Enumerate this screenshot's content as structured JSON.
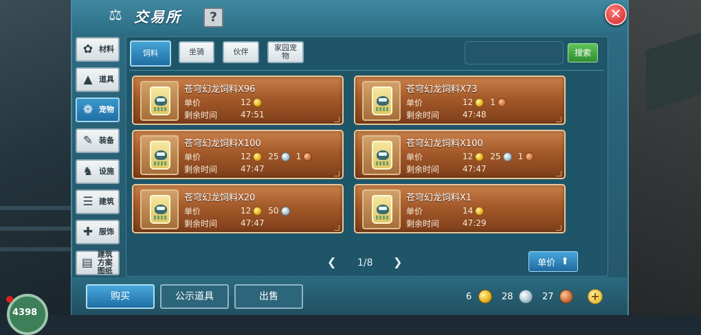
{
  "window": {
    "title": "交易所",
    "help_label": "?",
    "close_label": "✕"
  },
  "sidebar": {
    "items": [
      {
        "label": "材料",
        "icon": "material-icon",
        "active": false
      },
      {
        "label": "道具",
        "icon": "item-icon",
        "active": false
      },
      {
        "label": "宠物",
        "icon": "paw-icon",
        "active": true
      },
      {
        "label": "装备",
        "icon": "equipment-icon",
        "active": false
      },
      {
        "label": "设施",
        "icon": "facility-icon",
        "active": false
      },
      {
        "label": "建筑",
        "icon": "building-icon",
        "active": false
      },
      {
        "label": "服饰",
        "icon": "clothing-icon",
        "active": false
      },
      {
        "label": "建筑方案图纸",
        "icon": "blueprint-icon",
        "active": false
      }
    ]
  },
  "tabs": [
    {
      "label": "饲料",
      "active": true
    },
    {
      "label": "坐骑",
      "active": false
    },
    {
      "label": "伙伴",
      "active": false
    },
    {
      "label": "家园宠物",
      "active": false
    }
  ],
  "search": {
    "placeholder": "",
    "button_label": "搜索"
  },
  "labels": {
    "unit_price": "单价",
    "time_left": "剩余时间"
  },
  "listings": [
    {
      "name": "苍穹幻龙饲料X96",
      "gold": "12",
      "silver": "",
      "copper": "",
      "time": "47:51"
    },
    {
      "name": "苍穹幻龙饲料X73",
      "gold": "12",
      "silver": "",
      "copper": "1",
      "time": "47:48"
    },
    {
      "name": "苍穹幻龙饲料X100",
      "gold": "12",
      "silver": "25",
      "copper": "1",
      "time": "47:47"
    },
    {
      "name": "苍穹幻龙饲料X100",
      "gold": "12",
      "silver": "25",
      "copper": "1",
      "time": "47:47"
    },
    {
      "name": "苍穹幻龙饲料X20",
      "gold": "12",
      "silver": "50",
      "copper": "",
      "time": "47:47"
    },
    {
      "name": "苍穹幻龙饲料X1",
      "gold": "14",
      "silver": "",
      "copper": "",
      "time": "47:29"
    }
  ],
  "pagination": {
    "prev": "❮",
    "label": "1/8",
    "next": "❯"
  },
  "sort": {
    "label": "单价",
    "icon": "sort-arrow-icon"
  },
  "footer": {
    "buy_label": "购买",
    "public_label": "公示道具",
    "sell_label": "出售",
    "gold": "6",
    "silver": "28",
    "copper": "27",
    "add_label": "+"
  },
  "hud": {
    "number": "4398"
  },
  "colors": {
    "accent": "#1f6ea4",
    "listing_bg": "#a45a2a",
    "panel_bg": "#2a6278",
    "search_green": "#2f8e33",
    "close_red": "#d02424"
  }
}
